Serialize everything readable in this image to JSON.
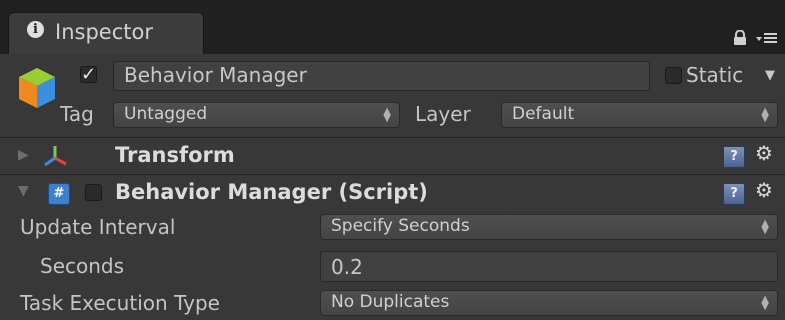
{
  "window": {
    "tab_title": "Inspector",
    "tab_icon": "info-icon",
    "header_icons": [
      "lock-icon",
      "menu-icon"
    ]
  },
  "gameobject": {
    "icon": "gameobject-cube-icon",
    "active": true,
    "name": "Behavior Manager",
    "static_label": "Static",
    "static_checked": false,
    "tag_label": "Tag",
    "tag_value": "Untagged",
    "layer_label": "Layer",
    "layer_value": "Default"
  },
  "components": {
    "transform": {
      "title": "Transform",
      "expanded": false,
      "icon": "transform-axes-icon"
    },
    "script": {
      "title": "Behavior Manager (Script)",
      "expanded": true,
      "enabled": false,
      "icon": "csharp-script-icon",
      "fields": {
        "update_interval_label": "Update Interval",
        "update_interval_value": "Specify Seconds",
        "seconds_label": "Seconds",
        "seconds_value": "0.2",
        "task_execution_label": "Task Execution Type",
        "task_execution_value": "No Duplicates"
      }
    }
  },
  "colors": {
    "background": "#383838",
    "tabbar": "#202020",
    "help_icon": "#5f78a8",
    "script_icon": "#3a7fd0"
  }
}
